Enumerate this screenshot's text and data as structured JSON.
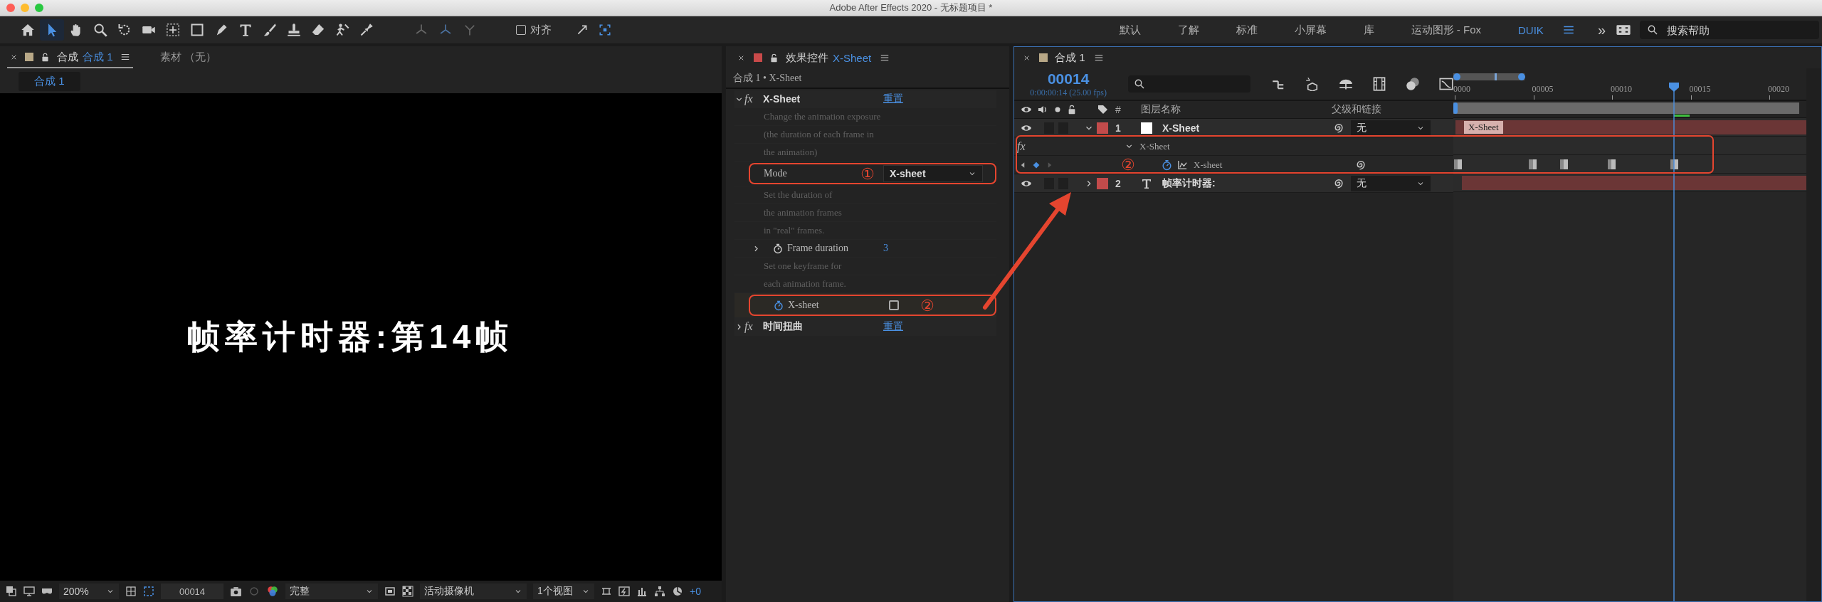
{
  "window": {
    "title": "Adobe After Effects 2020 - 无标题项目 *"
  },
  "toolbar": {
    "tools": [
      {
        "kind": "home",
        "selected": false
      },
      {
        "kind": "selection",
        "selected": true
      },
      {
        "kind": "hand",
        "selected": false
      },
      {
        "kind": "zoom",
        "selected": false
      },
      {
        "kind": "rotation",
        "selected": false
      },
      {
        "kind": "camera",
        "selected": false
      },
      {
        "kind": "panbehind",
        "selected": false
      },
      {
        "kind": "shape",
        "selected": false
      },
      {
        "kind": "pen",
        "selected": false
      },
      {
        "kind": "type",
        "selected": false
      },
      {
        "kind": "brush",
        "selected": false
      },
      {
        "kind": "stamp",
        "selected": false
      },
      {
        "kind": "eraser",
        "selected": false
      },
      {
        "kind": "roto",
        "selected": false
      },
      {
        "kind": "puppet",
        "selected": false
      }
    ],
    "snap": {
      "label": "对齐",
      "checked": false
    },
    "workspaces": [
      {
        "label": "默认",
        "selected": false
      },
      {
        "label": "了解",
        "selected": false
      },
      {
        "label": "标准",
        "selected": false
      },
      {
        "label": "小屏幕",
        "selected": false
      },
      {
        "label": "库",
        "selected": false
      },
      {
        "label": "运动图形 - Fox",
        "selected": false
      },
      {
        "label": "DUIK",
        "selected": true
      }
    ],
    "overflow": "»",
    "search": {
      "placeholder": "搜索帮助"
    }
  },
  "composition_panel": {
    "tabs": [
      {
        "label": "合成",
        "comp": "合成 1",
        "selected": true
      },
      {
        "label": "素材 （无）",
        "selected": false
      }
    ],
    "viewer_tab": "合成 1",
    "viewer_text": "帧率计时器:第14帧",
    "footer": {
      "magnification": "200%",
      "timecode": "00014",
      "resolution": "完整",
      "camera": "活动摄像机",
      "views": "1个视图",
      "exposure": "+0"
    }
  },
  "effect_controls": {
    "title": "效果控件",
    "layer": "X-Sheet",
    "breadcrumb": "合成 1 • X-Sheet",
    "effects": [
      {
        "badge": "fx",
        "name": "X-Sheet",
        "expanded": true,
        "reset": "重置",
        "rows": [
          {
            "kind": "note",
            "text": "Change the animation exposure"
          },
          {
            "kind": "note",
            "text": "(the duration of each frame in"
          },
          {
            "kind": "note",
            "text": "the animation)"
          },
          {
            "kind": "dropdown",
            "label": "Mode",
            "value": "X-sheet",
            "callout": "①"
          },
          {
            "kind": "note",
            "text": "Set the duration of"
          },
          {
            "kind": "note",
            "text": "the animation frames"
          },
          {
            "kind": "note",
            "text": "in \"real\" frames."
          },
          {
            "kind": "number",
            "label": "Frame duration",
            "value": "3",
            "expanded": false,
            "animated": false
          },
          {
            "kind": "note",
            "text": "Set one keyframe for"
          },
          {
            "kind": "note",
            "text": "each animation frame."
          },
          {
            "kind": "checkbox",
            "label": "X-sheet",
            "checked": false,
            "animated": true,
            "callout": "②"
          }
        ]
      },
      {
        "badge": "fx",
        "name": "时间扭曲",
        "expanded": false,
        "reset": "重置"
      }
    ]
  },
  "timeline": {
    "tab": "合成 1",
    "timecode": "00014",
    "timecode_detail": "0:00:00:14 (25.00 fps)",
    "columns": {
      "number": "#",
      "name": "图层名称",
      "parent": "父级和链接"
    },
    "ruler": [
      "0000",
      "00005",
      "00010",
      "00015",
      "00020"
    ],
    "playhead": {
      "level": 0.626
    },
    "layers": [
      {
        "number": "1",
        "name": "X-Sheet",
        "kind": "solid",
        "solo": false,
        "locked": false,
        "expanded": true,
        "parent": "无",
        "bar_label": "X-Sheet",
        "effects": [
          {
            "badge": "fx",
            "name": "X-Sheet",
            "expanded": true,
            "properties": [
              {
                "name": "X-sheet",
                "animated": true,
                "callout": "②",
                "keyframes": [
                  {
                    "level": 0.012
                  },
                  {
                    "level": 0.224
                  },
                  {
                    "level": 0.313
                  },
                  {
                    "level": 0.447
                  },
                  {
                    "level": 0.626
                  }
                ]
              }
            ]
          }
        ]
      },
      {
        "number": "2",
        "name": "帧率计时器:",
        "kind": "text",
        "solo": false,
        "locked": false,
        "expanded": false,
        "parent": "无"
      }
    ]
  }
}
